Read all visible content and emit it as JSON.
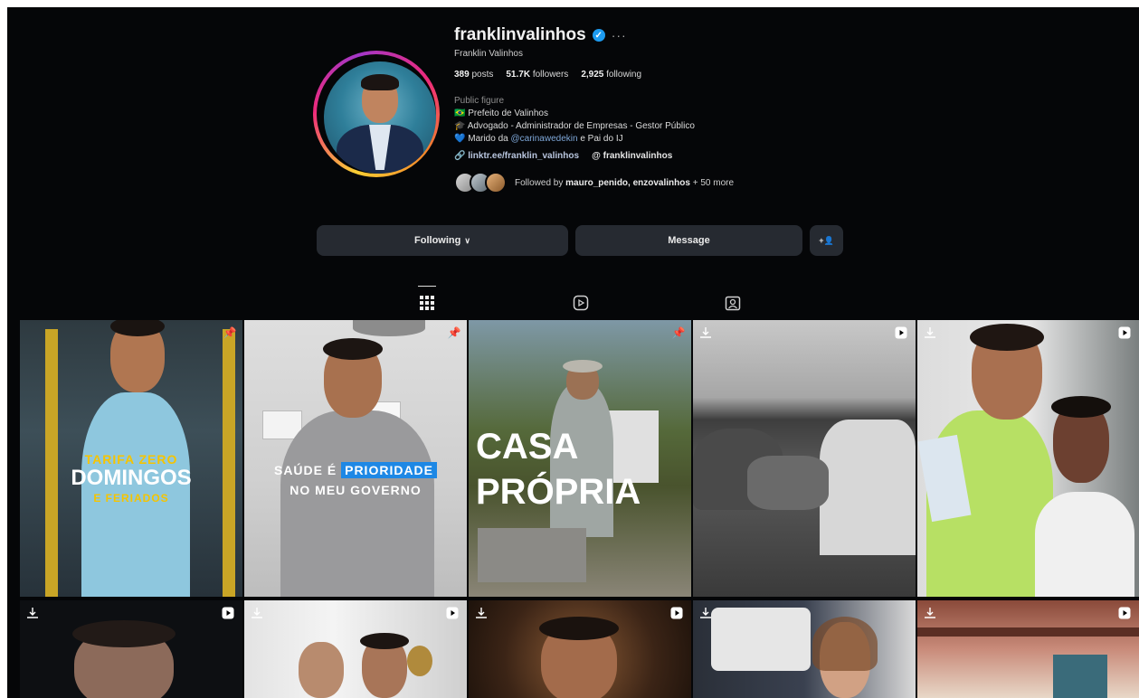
{
  "profile": {
    "username": "franklinvalinhos",
    "more": "···",
    "full_name": "Franklin Valinhos",
    "posts_count": "389",
    "posts_label": "posts",
    "followers_count": "51.7K",
    "followers_label": "followers",
    "following_count": "2,925",
    "following_label": "following",
    "category": "Public figure",
    "bio": {
      "line1_flag": "🇧🇷",
      "line1": "Prefeito de Valinhos",
      "line2_icon": "🎓",
      "line2": "Advogado - Administrador de Empresas - Gestor Público",
      "line3_icon": "💙",
      "line3_prefix": "Marido da",
      "line3_mention": "@carinawedekin",
      "line3_suffix": "e Pai do IJ"
    },
    "link_icon": "🔗",
    "link": "linktr.ee/franklin_valinhos",
    "threads_icon": "@",
    "threads": "franklinvalinhos",
    "followed_by_prefix": "Followed by",
    "followed_by_names": "mauro_penido, enzovalinhos",
    "followed_by_more": "+ 50 more"
  },
  "actions": {
    "following": "Following",
    "message": "Message",
    "suggest_icon": "+👤"
  },
  "tabs": [
    "posts",
    "reels",
    "tagged"
  ],
  "posts": [
    {
      "line1": "TARIFA ZERO",
      "line2": "DOMINGOS",
      "line3": "E FERIADOS"
    },
    {
      "line1": "SAÚDE É",
      "highlight": "PRIORIDADE",
      "line2": "NO MEU GOVERNO"
    },
    {
      "line1": "CASA",
      "line2": "PRÓPRIA"
    }
  ],
  "colors": {
    "accent": "#1d9bf0",
    "background": "#050608",
    "button": "#262a31",
    "tarifa_yellow": "#f5c400",
    "prioridade_blue": "#1e88e5"
  }
}
